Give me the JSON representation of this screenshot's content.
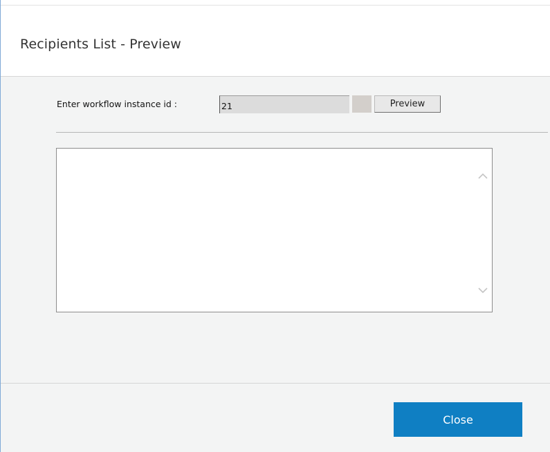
{
  "dialog": {
    "title": "Recipients List - Preview"
  },
  "form": {
    "id_label": "Enter workflow instance id :",
    "id_value": "21",
    "preview_label": "Preview"
  },
  "results": {
    "text": ""
  },
  "footer": {
    "close_label": "Close"
  },
  "colors": {
    "accent": "#0f7fc3",
    "body_background": "#f3f4f4",
    "input_background": "#dcdcdc"
  },
  "icons": {
    "scroll_up": "chevron-up-icon",
    "scroll_down": "chevron-down-icon"
  }
}
